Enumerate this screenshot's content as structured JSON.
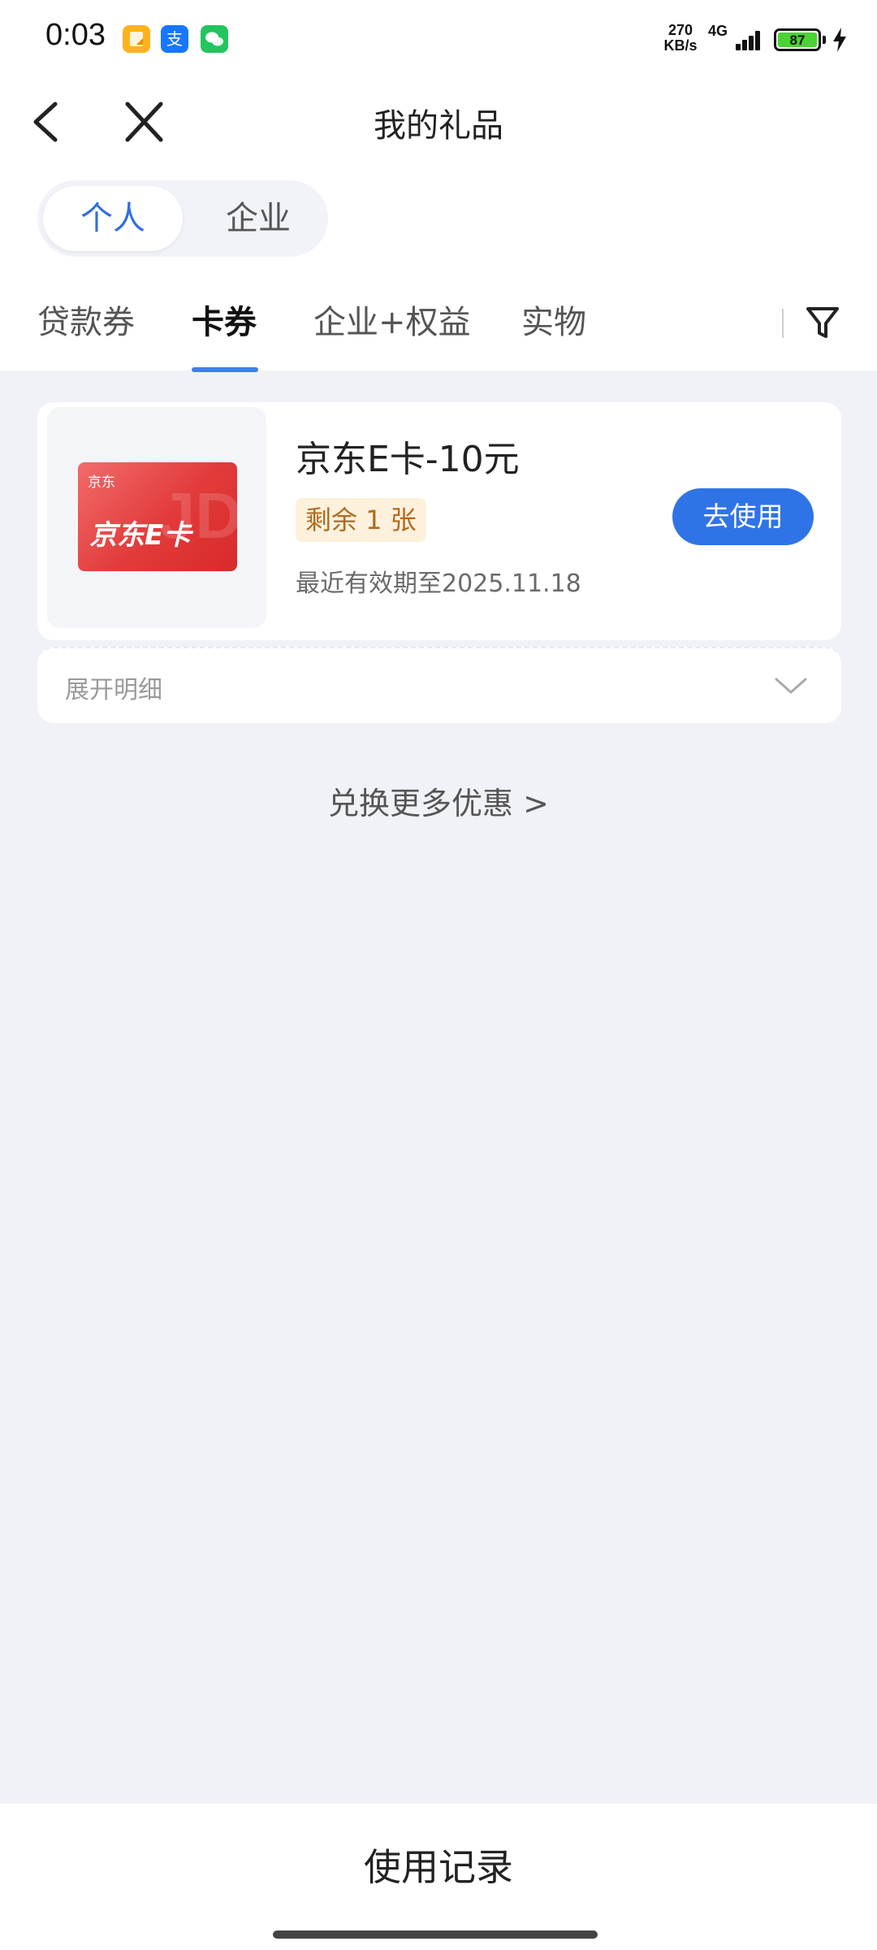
{
  "status_bar": {
    "time": "0:03",
    "app_icons": [
      {
        "name": "notes-app-icon",
        "color": "#ffb21e"
      },
      {
        "name": "alipay-icon",
        "glyph": "支",
        "color": "#1677ff"
      },
      {
        "name": "wechat-icon",
        "color": "#22c55e"
      }
    ],
    "net_speed_value": "270",
    "net_speed_unit": "KB/s",
    "network_type": "4G",
    "battery_level": "87",
    "battery_color": "#4cd137"
  },
  "header": {
    "title": "我的礼品"
  },
  "segment": {
    "items": [
      "个人",
      "企业"
    ],
    "selected": "个人",
    "accent": "#2f6fe0"
  },
  "tabs": {
    "items": [
      "贷款券",
      "卡券",
      "企业+权益",
      "实物"
    ],
    "active": "卡券",
    "underline_color": "#3f7ef0"
  },
  "gift_card": {
    "image_top_text": "京东",
    "image_main_text": "京东E卡",
    "image_watermark": "JD",
    "title": "京东E卡-10元",
    "remaining": "剩余 1 张",
    "expiry": "最近有效期至2025.11.18",
    "action_label": "去使用",
    "action_color": "#2f74e6"
  },
  "expand": {
    "label": "展开明细"
  },
  "more_link": "兑换更多优惠 >",
  "bottom": {
    "label": "使用记录"
  }
}
